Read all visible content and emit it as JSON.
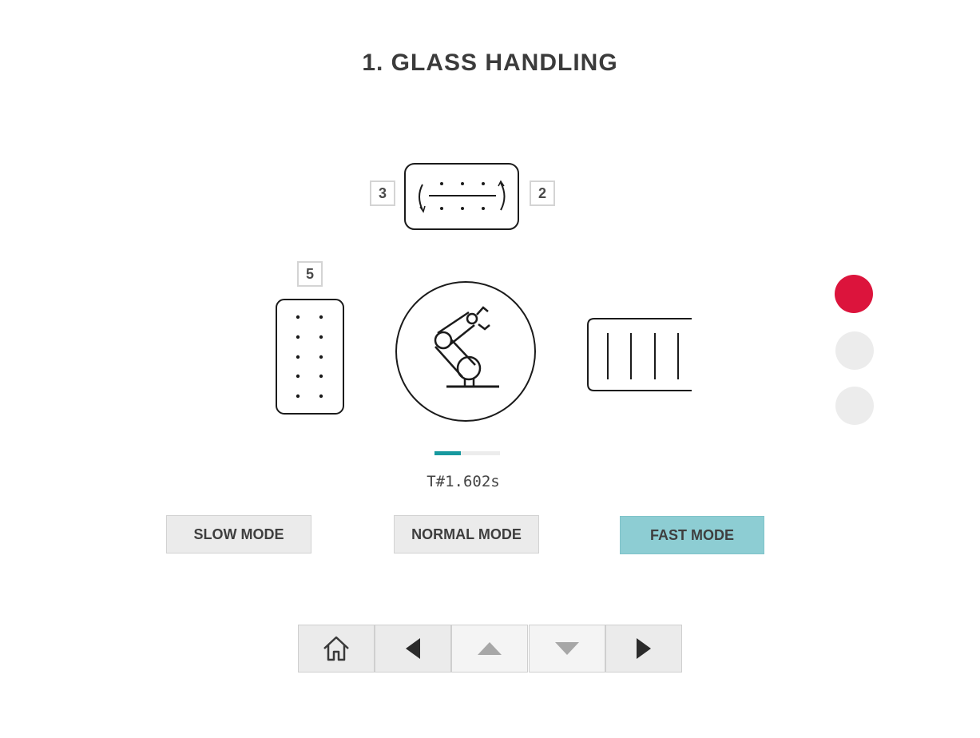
{
  "header": {
    "title": "1. GLASS HANDLING"
  },
  "stations": {
    "top_left_label": "3",
    "top_right_label": "2",
    "left_label": "5"
  },
  "progress": {
    "fraction": 0.4
  },
  "timer": {
    "value": "T#1.602s"
  },
  "modes": [
    {
      "label": "SLOW MODE",
      "active": false
    },
    {
      "label": "NORMAL MODE",
      "active": false
    },
    {
      "label": "FAST MODE",
      "active": true
    }
  ],
  "status_lights": [
    {
      "color": "#dc143c",
      "state": "on"
    },
    {
      "color": "#ececec",
      "state": "off"
    },
    {
      "color": "#ececec",
      "state": "off"
    }
  ],
  "navigation": [
    {
      "icon": "home-icon"
    },
    {
      "icon": "arrow-left-icon"
    },
    {
      "icon": "arrow-up-icon"
    },
    {
      "icon": "arrow-down-icon"
    },
    {
      "icon": "arrow-right-icon"
    }
  ],
  "colors": {
    "accent": "#17999f",
    "active_mode": "#8dcdd3",
    "alarm": "#dc143c"
  }
}
